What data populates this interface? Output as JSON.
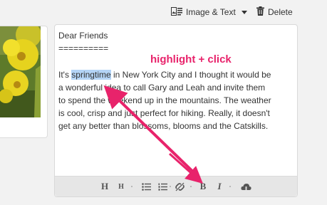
{
  "toolbar": {
    "block_type_label": "Image & Text",
    "block_type_icon": "image-text-icon",
    "delete_label": "Delete",
    "delete_icon": "trash-icon"
  },
  "editor": {
    "lines": [
      "Dear Friends",
      "==========",
      "",
      "",
      "a wonderful idea to call Gary and Leah and invite them",
      "to spend the weekend up in the mountains. The weather",
      "is cool, crisp and just perfect for hiking. Really, it doesn't",
      "get any better than blossoms, blooms and the Catskills."
    ],
    "line4_prefix": "It's ",
    "line4_selected": "springtime",
    "line4_suffix": " in New York City and I thought it would be"
  },
  "format_bar": {
    "heading1": "H",
    "heading2": "H",
    "bold": "B",
    "italic": "I",
    "icons": [
      "heading-large-icon",
      "heading-small-icon",
      "bullet-list-icon",
      "numbered-list-icon",
      "unlink-icon",
      "bold-icon",
      "italic-icon",
      "cloud-icon"
    ]
  },
  "annotation": {
    "text": "highlight + click",
    "color": "#e8236b"
  },
  "colors": {
    "selection": "#b4d4f6",
    "accent": "#e8236b",
    "background": "#f2f2f2"
  }
}
